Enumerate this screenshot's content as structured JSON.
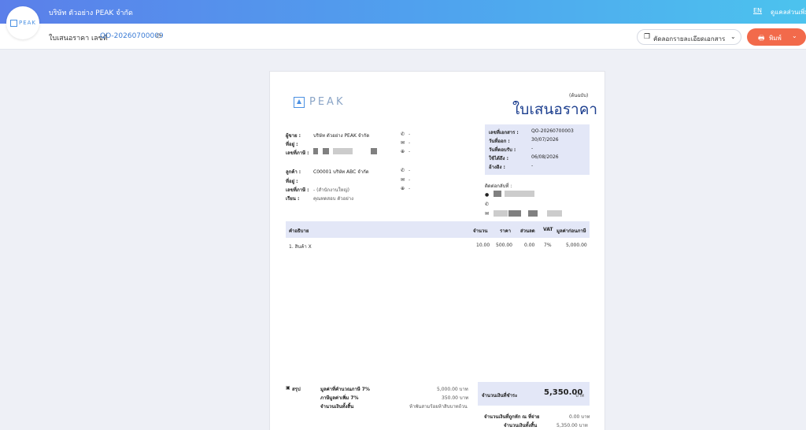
{
  "app": {
    "logo_text": "PEAK",
    "company_name": "บริษัท ตัวอย่าง PEAK จำกัด",
    "language": "EN",
    "user_link": "ดูแคลส่วนเพิ่มเติม"
  },
  "header": {
    "doc_label": "ใบเสนอราคา เลขที่",
    "doc_number": "QO-20260700009",
    "copy_button": "คัดลอกรายละเอียดเอกสาร",
    "print_button": "พิมพ์"
  },
  "document": {
    "logo_text": "PEAK",
    "original_label": "(ต้นฉบับ)",
    "title": "ใบเสนอราคา",
    "seller": {
      "label_seller": "ผู้ขาย :",
      "seller_name": "บริษัท ตัวอย่าง PEAK จำกัด",
      "label_address": "ที่อยู่ :",
      "label_taxid": "เลขที่ภาษี :",
      "phone": "-",
      "email": "-",
      "web": "-"
    },
    "customer": {
      "label_customer": "ลูกค้า :",
      "customer_name": "C00001 บริษัท ABC จำกัด",
      "label_address": "ที่อยู่ :",
      "label_taxid": "เลขที่ภาษี :",
      "taxid_value": "- (สำนักงานใหญ่)",
      "label_attn": "เรียน :",
      "attn_value": "คุณทดสอบ ตัวอย่าง",
      "phone": "-",
      "email": "-",
      "web": "-"
    },
    "info": {
      "label_docno": "เลขที่เอกสาร :",
      "docno": "QO-20260700003",
      "label_issue": "วันที่ออก :",
      "issue": "30/07/2026",
      "label_due": "วันที่ตอบรับ :",
      "due": "-",
      "label_valid": "ใช้ได้ถึง :",
      "valid": "06/08/2026",
      "label_ref": "อ้างอิง :",
      "ref": "-"
    },
    "contact_label": "ติดต่อกลับที่ :",
    "table": {
      "headers": [
        "คำอธิบาย",
        "จำนวน",
        "ราคา",
        "ส่วนลด",
        "VAT",
        "มูลค่าก่อนภาษี"
      ],
      "rows": [
        {
          "desc": "1. สินค้า X",
          "qty": "10.00",
          "price": "500.00",
          "discount": "0.00",
          "vat": "7%",
          "amount": "5,000.00"
        }
      ]
    },
    "summary": {
      "summary_label": "สรุป",
      "pretax_label": "มูลค่าที่คำนวณภาษี 7%",
      "pretax_value": "5,000.00 บาท",
      "vat_label": "ภาษีมูลค่าเพิ่ม 7%",
      "vat_value": "350.00 บาท",
      "words_label": "จำนวนเงินทั้งสิ้น",
      "words_value": "ห้าพันสามร้อยห้าสิบบาทถ้วน",
      "total_label": "จำนวนเงินที่ชำระ",
      "total_value": "5,350.00",
      "total_unit": "บาท",
      "withholding_label": "จำนวนเงินที่ถูกหัก ณ ที่จ่าย",
      "withholding_value": "0.00 บาท",
      "grand_label": "จำนวนเงินทั้งสิ้น",
      "grand_value": "5,350.00 บาท"
    }
  },
  "colors": {
    "accent": "#3a7bd5",
    "title": "#1d3f8f",
    "print_button": "#f26a4b",
    "panel": "#e3e7f7"
  }
}
